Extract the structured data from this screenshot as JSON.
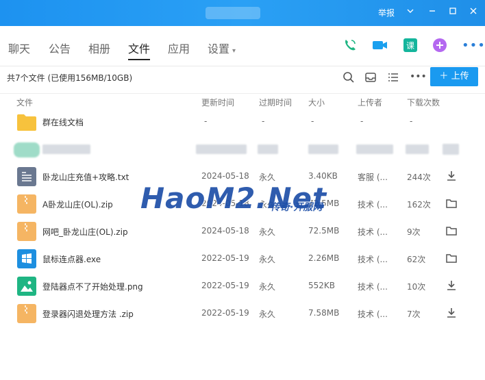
{
  "titlebar": {
    "report_label": "举报"
  },
  "tabs": [
    {
      "label": "聊天"
    },
    {
      "label": "公告"
    },
    {
      "label": "相册"
    },
    {
      "label": "文件"
    },
    {
      "label": "应用"
    },
    {
      "label": "设置"
    }
  ],
  "active_tab": "文件",
  "summary": "共7个文件 (已使用156MB/10GB)",
  "upload_label": "上传",
  "columns": [
    "文件",
    "更新时间",
    "过期时间",
    "大小",
    "上传者",
    "下载次数"
  ],
  "group_folder": {
    "name": "群在线文档",
    "updated": "-",
    "expire": "-",
    "size": "-",
    "uploader": "-",
    "downloads": "-"
  },
  "files": [
    {
      "name": "卧龙山庄充值+攻略.txt",
      "updated": "2024-05-18",
      "expire": "永久",
      "size": "3.40KB",
      "uploader": "客服 (...",
      "downloads": "244次",
      "icon": "text-file-icon",
      "action": "download-icon"
    },
    {
      "name": "A卧龙山庄(OL).zip",
      "updated": "2024-05-18",
      "expire": "永久",
      "size": "72.5MB",
      "uploader": "技术 (...",
      "downloads": "162次",
      "icon": "zip-file-icon",
      "action": "folder-icon"
    },
    {
      "name": "网吧_卧龙山庄(OL).zip",
      "updated": "2024-05-18",
      "expire": "永久",
      "size": "72.5MB",
      "uploader": "技术 (...",
      "downloads": "9次",
      "icon": "zip-file-icon",
      "action": "folder-icon"
    },
    {
      "name": "鼠标连点器.exe",
      "updated": "2022-05-19",
      "expire": "永久",
      "size": "2.26MB",
      "uploader": "技术 (...",
      "downloads": "62次",
      "icon": "exe-file-icon",
      "action": "folder-icon"
    },
    {
      "name": "登陆器点不了开始处理.png",
      "updated": "2022-05-19",
      "expire": "永久",
      "size": "552KB",
      "uploader": "技术 (...",
      "downloads": "10次",
      "icon": "image-file-icon",
      "action": "download-icon"
    },
    {
      "name": "登录器闪退处理方法 .zip",
      "updated": "2022-05-19",
      "expire": "永久",
      "size": "7.58MB",
      "uploader": "技术 (...",
      "downloads": "7次",
      "icon": "zip-file-icon",
      "action": "download-icon"
    }
  ],
  "watermark": {
    "main": "HaoM2.Net",
    "sub": "传奇·开服网"
  },
  "colors": {
    "titlebar": "#1d92f0",
    "accent": "#1a9af0",
    "folder": "#f7c23d",
    "zip": "#f5b563",
    "text_file": "#6a7890",
    "exe": "#1d8fe0",
    "image": "#1fb583"
  }
}
